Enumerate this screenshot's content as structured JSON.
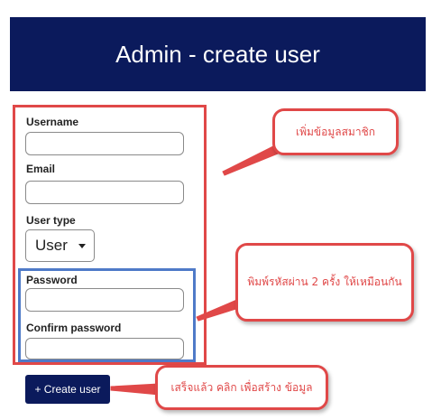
{
  "header": {
    "title": "Admin - create user"
  },
  "form": {
    "username_label": "Username",
    "username_value": "",
    "email_label": "Email",
    "email_value": "",
    "user_type_label": "User type",
    "user_type_selected": "User",
    "password_label": "Password",
    "password_value": "",
    "confirm_password_label": "Confirm password",
    "confirm_password_value": ""
  },
  "actions": {
    "create_user_label": "+ Create user"
  },
  "annotations": {
    "member_info": "เพิ่มข้อมูลสมาชิก",
    "password_match": "พิมพ์รหัสผ่าน 2 ครั้ง ให้เหมือนกัน",
    "click_to_create": "เสร็จแล้ว คลิก เพื่อสร้าง ข้อมูล"
  },
  "colors": {
    "header_bg": "#0b1a5c",
    "annotation_red": "#e04848",
    "annotation_blue": "#4f7ac8"
  }
}
